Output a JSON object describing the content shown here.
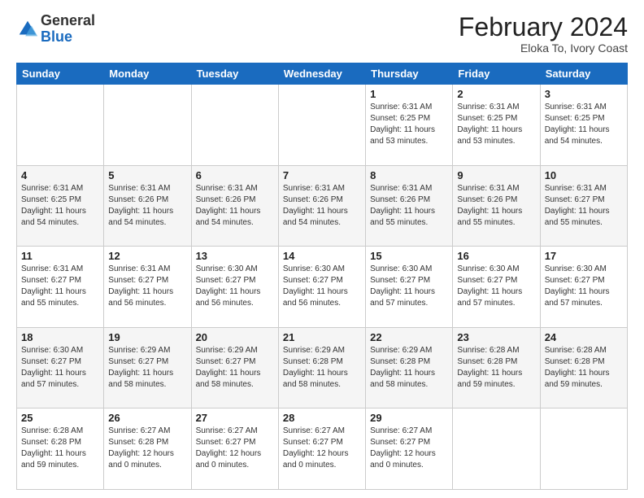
{
  "header": {
    "logo_general": "General",
    "logo_blue": "Blue",
    "month_year": "February 2024",
    "location": "Eloka To, Ivory Coast"
  },
  "days_of_week": [
    "Sunday",
    "Monday",
    "Tuesday",
    "Wednesday",
    "Thursday",
    "Friday",
    "Saturday"
  ],
  "weeks": [
    [
      {
        "day": "",
        "info": ""
      },
      {
        "day": "",
        "info": ""
      },
      {
        "day": "",
        "info": ""
      },
      {
        "day": "",
        "info": ""
      },
      {
        "day": "1",
        "info": "Sunrise: 6:31 AM\nSunset: 6:25 PM\nDaylight: 11 hours\nand 53 minutes."
      },
      {
        "day": "2",
        "info": "Sunrise: 6:31 AM\nSunset: 6:25 PM\nDaylight: 11 hours\nand 53 minutes."
      },
      {
        "day": "3",
        "info": "Sunrise: 6:31 AM\nSunset: 6:25 PM\nDaylight: 11 hours\nand 54 minutes."
      }
    ],
    [
      {
        "day": "4",
        "info": "Sunrise: 6:31 AM\nSunset: 6:25 PM\nDaylight: 11 hours\nand 54 minutes."
      },
      {
        "day": "5",
        "info": "Sunrise: 6:31 AM\nSunset: 6:26 PM\nDaylight: 11 hours\nand 54 minutes."
      },
      {
        "day": "6",
        "info": "Sunrise: 6:31 AM\nSunset: 6:26 PM\nDaylight: 11 hours\nand 54 minutes."
      },
      {
        "day": "7",
        "info": "Sunrise: 6:31 AM\nSunset: 6:26 PM\nDaylight: 11 hours\nand 54 minutes."
      },
      {
        "day": "8",
        "info": "Sunrise: 6:31 AM\nSunset: 6:26 PM\nDaylight: 11 hours\nand 55 minutes."
      },
      {
        "day": "9",
        "info": "Sunrise: 6:31 AM\nSunset: 6:26 PM\nDaylight: 11 hours\nand 55 minutes."
      },
      {
        "day": "10",
        "info": "Sunrise: 6:31 AM\nSunset: 6:27 PM\nDaylight: 11 hours\nand 55 minutes."
      }
    ],
    [
      {
        "day": "11",
        "info": "Sunrise: 6:31 AM\nSunset: 6:27 PM\nDaylight: 11 hours\nand 55 minutes."
      },
      {
        "day": "12",
        "info": "Sunrise: 6:31 AM\nSunset: 6:27 PM\nDaylight: 11 hours\nand 56 minutes."
      },
      {
        "day": "13",
        "info": "Sunrise: 6:30 AM\nSunset: 6:27 PM\nDaylight: 11 hours\nand 56 minutes."
      },
      {
        "day": "14",
        "info": "Sunrise: 6:30 AM\nSunset: 6:27 PM\nDaylight: 11 hours\nand 56 minutes."
      },
      {
        "day": "15",
        "info": "Sunrise: 6:30 AM\nSunset: 6:27 PM\nDaylight: 11 hours\nand 57 minutes."
      },
      {
        "day": "16",
        "info": "Sunrise: 6:30 AM\nSunset: 6:27 PM\nDaylight: 11 hours\nand 57 minutes."
      },
      {
        "day": "17",
        "info": "Sunrise: 6:30 AM\nSunset: 6:27 PM\nDaylight: 11 hours\nand 57 minutes."
      }
    ],
    [
      {
        "day": "18",
        "info": "Sunrise: 6:30 AM\nSunset: 6:27 PM\nDaylight: 11 hours\nand 57 minutes."
      },
      {
        "day": "19",
        "info": "Sunrise: 6:29 AM\nSunset: 6:27 PM\nDaylight: 11 hours\nand 58 minutes."
      },
      {
        "day": "20",
        "info": "Sunrise: 6:29 AM\nSunset: 6:27 PM\nDaylight: 11 hours\nand 58 minutes."
      },
      {
        "day": "21",
        "info": "Sunrise: 6:29 AM\nSunset: 6:28 PM\nDaylight: 11 hours\nand 58 minutes."
      },
      {
        "day": "22",
        "info": "Sunrise: 6:29 AM\nSunset: 6:28 PM\nDaylight: 11 hours\nand 58 minutes."
      },
      {
        "day": "23",
        "info": "Sunrise: 6:28 AM\nSunset: 6:28 PM\nDaylight: 11 hours\nand 59 minutes."
      },
      {
        "day": "24",
        "info": "Sunrise: 6:28 AM\nSunset: 6:28 PM\nDaylight: 11 hours\nand 59 minutes."
      }
    ],
    [
      {
        "day": "25",
        "info": "Sunrise: 6:28 AM\nSunset: 6:28 PM\nDaylight: 11 hours\nand 59 minutes."
      },
      {
        "day": "26",
        "info": "Sunrise: 6:27 AM\nSunset: 6:28 PM\nDaylight: 12 hours\nand 0 minutes."
      },
      {
        "day": "27",
        "info": "Sunrise: 6:27 AM\nSunset: 6:27 PM\nDaylight: 12 hours\nand 0 minutes."
      },
      {
        "day": "28",
        "info": "Sunrise: 6:27 AM\nSunset: 6:27 PM\nDaylight: 12 hours\nand 0 minutes."
      },
      {
        "day": "29",
        "info": "Sunrise: 6:27 AM\nSunset: 6:27 PM\nDaylight: 12 hours\nand 0 minutes."
      },
      {
        "day": "",
        "info": ""
      },
      {
        "day": "",
        "info": ""
      }
    ]
  ]
}
